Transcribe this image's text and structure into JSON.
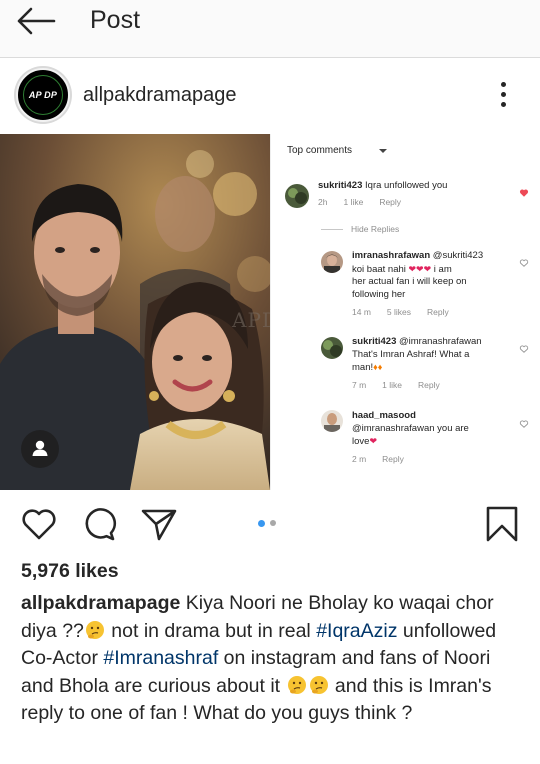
{
  "appbar": {
    "title": "Post",
    "back_icon": "arrow-left-icon"
  },
  "post": {
    "username": "allpakdramapage",
    "avatar_text": "AP DP",
    "more_icon": "more-vertical-icon",
    "watermark": "APDP"
  },
  "comments": {
    "sort_label": "Top comments",
    "hide_replies": "Hide Replies",
    "items": [
      {
        "user": "sukriti423",
        "text": "Iqra unfollowed you",
        "time": "2h",
        "likes": "1 like",
        "reply": "Reply",
        "liked": true
      },
      {
        "user": "imranashrafawan",
        "text_lines": [
          "@sukriti423",
          "koi baat nahi",
          "i am",
          "her actual fan i will keep on",
          "following her"
        ],
        "time": "14 m",
        "likes": "5 likes",
        "reply": "Reply",
        "liked": false
      },
      {
        "user": "sukriti423",
        "text_lines": [
          "@imranashrafawan",
          "That's Imran Ashraf! What a",
          "man!"
        ],
        "time": "7 m",
        "likes": "1 like",
        "reply": "Reply",
        "liked": false
      },
      {
        "user": "haad_masood",
        "text_lines": [
          "@imranashrafawan",
          "you are",
          "love"
        ],
        "time": "2 m",
        "reply": "Reply",
        "liked": false
      }
    ]
  },
  "carousel": {
    "count": 2,
    "active_index": 0,
    "active_color": "#3897f0",
    "inactive_color": "#a8a8a8"
  },
  "likes": "5,976 likes",
  "caption": {
    "username": "allpakdramapage",
    "part1": "Kiya Noori ne Bholay ko waqai chor diya ??",
    "part2": " not in drama but  in real ",
    "hashtag1": "#IqraAziz",
    "part3": " unfollowed Co-Actor ",
    "hashtag2": "#Imranashraf",
    "part4": " on instagram and fans of Noori and Bhola are curious about it ",
    "part5": " and this is Imran's reply to one of fan ! What do you guys think ?"
  },
  "colors": {
    "text": "#262626",
    "muted": "#8e8e8e",
    "hashtag": "#003569",
    "heart_red": "#ed4956"
  }
}
